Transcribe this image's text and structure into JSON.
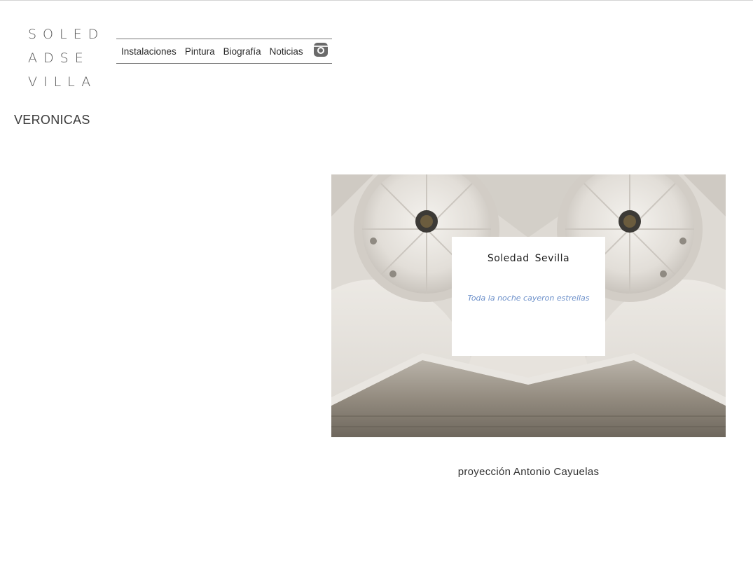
{
  "logo": {
    "lines": [
      "SOLED",
      "ADSE",
      "VILLA"
    ]
  },
  "nav": {
    "items": [
      {
        "label": "Instalaciones"
      },
      {
        "label": "Pintura"
      },
      {
        "label": "Biografía"
      },
      {
        "label": "Noticias"
      }
    ],
    "social_icon": "instagram-icon"
  },
  "page": {
    "title": "VERONICAS"
  },
  "artwork": {
    "card_name": "Soledad  Sevilla",
    "card_subtitle": "Toda la noche cayeron estrellas",
    "subtitle_color": "#6b8fc9"
  },
  "caption": "proyección Antonio Cayuelas"
}
